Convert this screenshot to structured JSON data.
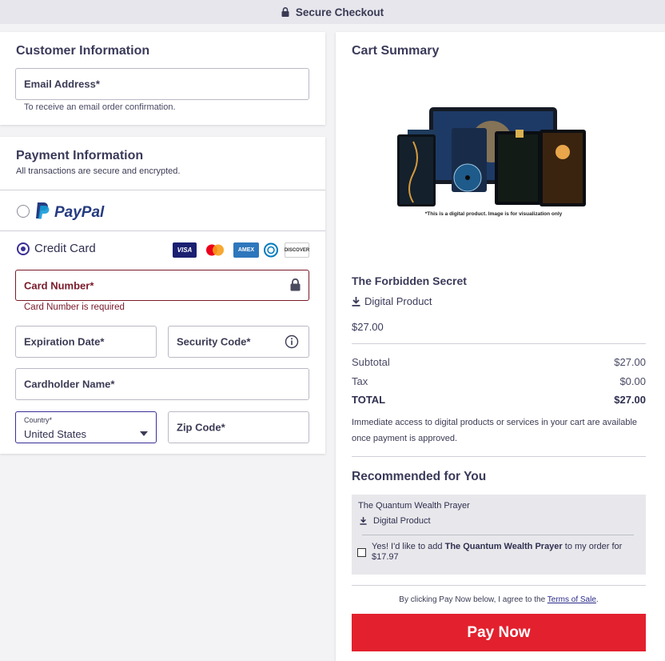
{
  "header": {
    "title": "Secure Checkout"
  },
  "customer": {
    "title": "Customer Information",
    "email_label": "Email Address*",
    "email_hint": "To receive an email order confirmation."
  },
  "payment": {
    "title": "Payment Information",
    "subtitle": "All transactions are secure and encrypted.",
    "paypal_label": "PayPal",
    "credit_card_label": "Credit Card",
    "card_brands": [
      "VISA",
      "Mastercard",
      "AMEX",
      "Diners Club",
      "DISCOVER"
    ],
    "card_number_label": "Card Number*",
    "card_number_error": "Card Number is required",
    "expiration_label": "Expiration Date*",
    "security_code_label": "Security Code*",
    "cardholder_label": "Cardholder Name*",
    "country_label": "Country*",
    "country_value": "United States",
    "zip_label": "Zip Code*"
  },
  "cart": {
    "title": "Cart Summary",
    "image_caption": "*This is a digital product. Image is for visualization only",
    "product_name": "The Forbidden Secret",
    "product_type": "Digital Product",
    "product_price": "$27.00",
    "subtotal_label": "Subtotal",
    "subtotal_value": "$27.00",
    "tax_label": "Tax",
    "tax_value": "$0.00",
    "total_label": "TOTAL",
    "total_value": "$27.00",
    "access_note": "Immediate access to digital products or services in your cart are available once payment is approved.",
    "recommended_title": "Recommended for You",
    "reco_name": "The Quantum Wealth Prayer",
    "reco_type": "Digital Product",
    "reco_offer_prefix": "Yes! I'd like to add ",
    "reco_offer_product": "The Quantum Wealth Prayer",
    "reco_offer_suffix": " to my order for $17.97",
    "terms_prefix": "By clicking Pay Now below, I agree to the ",
    "terms_link": "Terms of Sale",
    "terms_suffix": ".",
    "pay_button": "Pay Now"
  },
  "colors": {
    "accent": "#3a2f96",
    "error": "#7a1a2a",
    "pay_button": "#e3202e",
    "paypal_dark": "#253b80",
    "paypal_light": "#179bd7"
  }
}
